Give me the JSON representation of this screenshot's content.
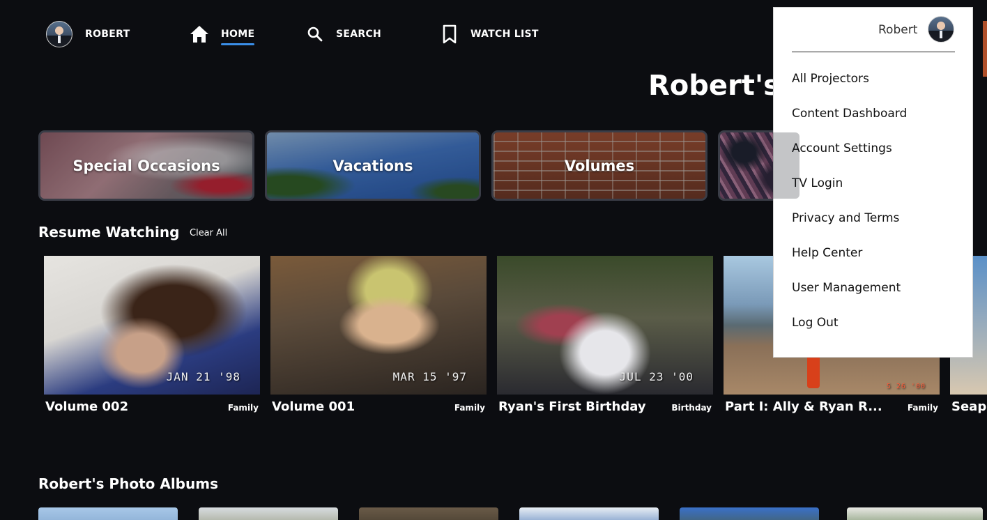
{
  "nav": {
    "user_name": "ROBERT",
    "home_label": "HOME",
    "search_label": "SEARCH",
    "watchlist_label": "WATCH LIST"
  },
  "page_title": "Robert's",
  "categories": [
    {
      "label": "Special Occasions"
    },
    {
      "label": "Vacations"
    },
    {
      "label": "Volumes"
    },
    {
      "label": ""
    }
  ],
  "resume": {
    "title": "Resume Watching",
    "clear_label": "Clear All",
    "items": [
      {
        "title": "Volume 002",
        "tag": "Family",
        "date": "JAN 21 '98"
      },
      {
        "title": "Volume 001",
        "tag": "Family",
        "date": "MAR 15 '97"
      },
      {
        "title": "Ryan's First Birthday",
        "tag": "Birthday",
        "date": "JUL 23 '00"
      },
      {
        "title": "Part I: Ally & Ryan R...",
        "tag": "Family",
        "date": "5 26 '00"
      },
      {
        "title": "Seap",
        "tag": "",
        "date": ""
      }
    ]
  },
  "albums": {
    "title": "Robert's Photo Albums"
  },
  "menu": {
    "user_name": "Robert",
    "items": [
      "All Projectors",
      "Content Dashboard",
      "Account Settings",
      "TV Login",
      "Privacy and Terms",
      "Help Center",
      "User Management",
      "Log Out"
    ]
  },
  "colors": {
    "background": "#0c0d11",
    "accent": "#3a8ee8",
    "menu_background": "#ffffff"
  },
  "icons": {
    "home": "home-icon",
    "search": "search-icon",
    "watchlist": "bookmark-icon"
  }
}
